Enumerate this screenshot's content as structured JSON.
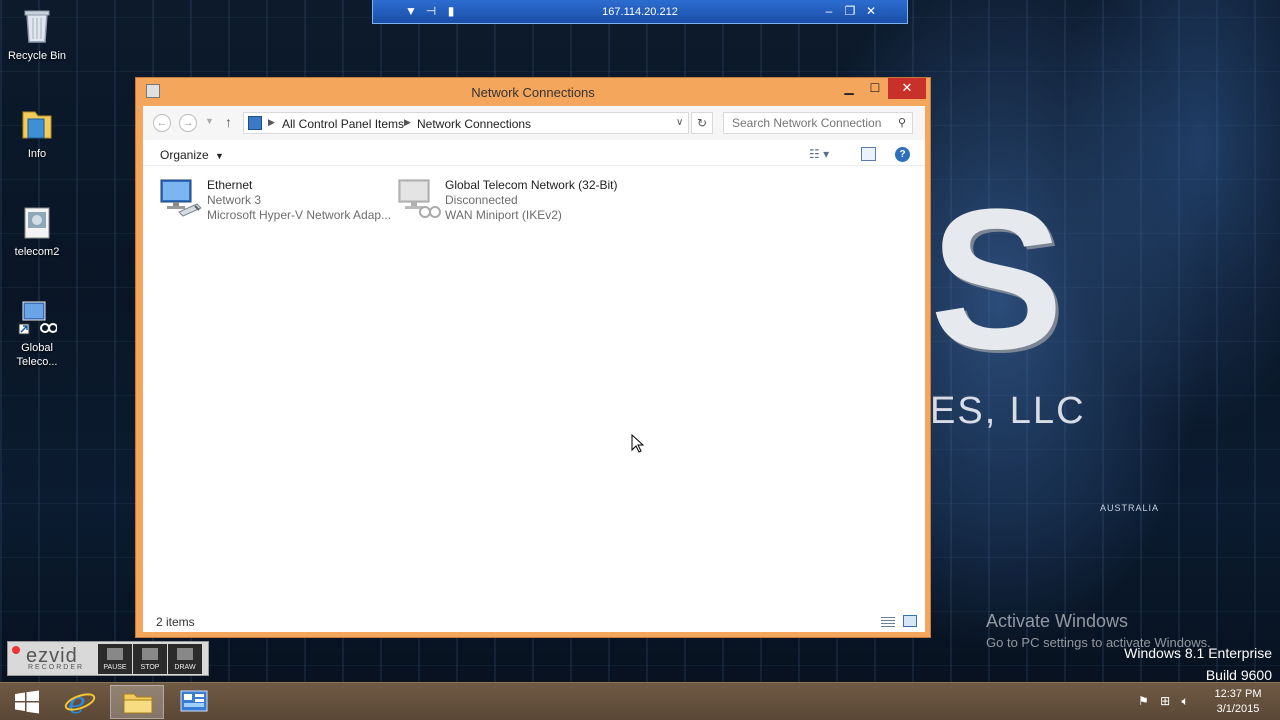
{
  "desktop": {
    "icons": [
      {
        "label": "Recycle Bin"
      },
      {
        "label": "Info"
      },
      {
        "label": "telecom2"
      },
      {
        "label": "Global Teleco..."
      }
    ],
    "brand_letters": "S",
    "brand_suffix": "ES, LLC",
    "map_label": "AUSTRALIA",
    "activation": {
      "title": "Activate Windows",
      "subtitle": "Go to PC settings to activate Windows."
    },
    "windows_version": "Windows 8.1 Enterprise",
    "build": "Build 9600"
  },
  "rdp_bar": {
    "address": "167.114.20.212"
  },
  "window": {
    "title": "Network Connections",
    "address": {
      "crumbs": [
        "All Control Panel Items",
        "Network Connections"
      ]
    },
    "search": {
      "placeholder": "Search Network Connections"
    },
    "toolbar": {
      "organize_label": "Organize"
    },
    "connections": [
      {
        "name": "Ethernet",
        "status": "Network  3",
        "device": "Microsoft Hyper-V Network Adap...",
        "state": "connected"
      },
      {
        "name": "Global Telecom Network (32-Bit)",
        "status": "Disconnected",
        "device": "WAN Miniport (IKEv2)",
        "state": "disconnected"
      }
    ],
    "status_bar": {
      "item_count": "2 items"
    }
  },
  "recorder": {
    "brand": "ezvid",
    "tagline": "RECORDER",
    "buttons": [
      "PAUSE",
      "STOP",
      "DRAW"
    ]
  },
  "taskbar": {
    "clock": {
      "time": "12:37 PM",
      "date": "3/1/2015"
    }
  },
  "colors": {
    "window_frame": "#f4a65d",
    "close_button": "#c7312a",
    "rdp_bar": "#1a4fa8",
    "taskbar": "#5a4735"
  }
}
